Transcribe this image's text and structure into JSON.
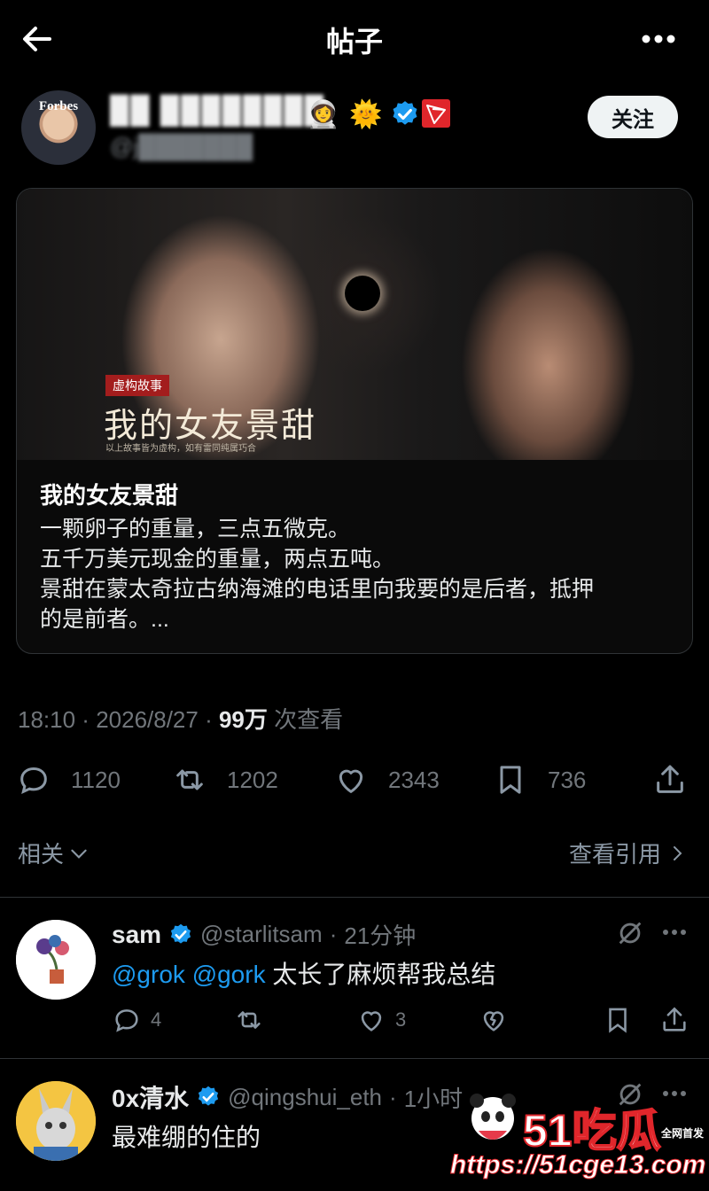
{
  "header": {
    "title": "帖子",
    "back_icon": "back-arrow-icon",
    "more_icon": "more-horizontal-icon"
  },
  "author": {
    "name": "██ ████████",
    "handle": "@j███████",
    "emojis": [
      "👩‍🚀",
      "🌞"
    ],
    "follow_label": "关注",
    "avatar_text": "Forbes"
  },
  "card": {
    "image": {
      "tag": "虚构故事",
      "title": "我的女友景甜",
      "subtitle": "以上故事皆为虚构，如有雷同纯属巧合"
    },
    "title": "我的女友景甜",
    "lines": [
      "一颗卵子的重量，三点五微克。",
      "五千万美元现金的重量，两点五吨。",
      "景甜在蒙太奇拉古纳海滩的电话里向我要的是后者，抵押",
      "的是前者。..."
    ]
  },
  "meta": {
    "time": "18:10",
    "date": "2026/8/27",
    "views": "99万",
    "views_label": "次查看"
  },
  "actions": {
    "replies": "1120",
    "reposts": "1202",
    "likes": "2343",
    "bookmarks": "736"
  },
  "related": {
    "label": "相关",
    "quote_label": "查看引用"
  },
  "replies": [
    {
      "name": "sam",
      "handle": "@starlitsam",
      "time": "21分钟",
      "mentions": [
        "@grok",
        "@gork"
      ],
      "text": "太长了麻烦帮我总结",
      "reply_count": "4",
      "like_count": "3"
    },
    {
      "name": "0x清水",
      "handle": "@qingshui_eth",
      "time": "1小时",
      "text": "最难绷的住的"
    }
  ],
  "watermark": {
    "logo": "51吃瓜",
    "corner": "全网首发",
    "url": "https://51cge13.com"
  },
  "colors": {
    "accent": "#1d9bf0",
    "verified": "#1d9bf0",
    "muted": "#71767b",
    "background": "#000000"
  }
}
